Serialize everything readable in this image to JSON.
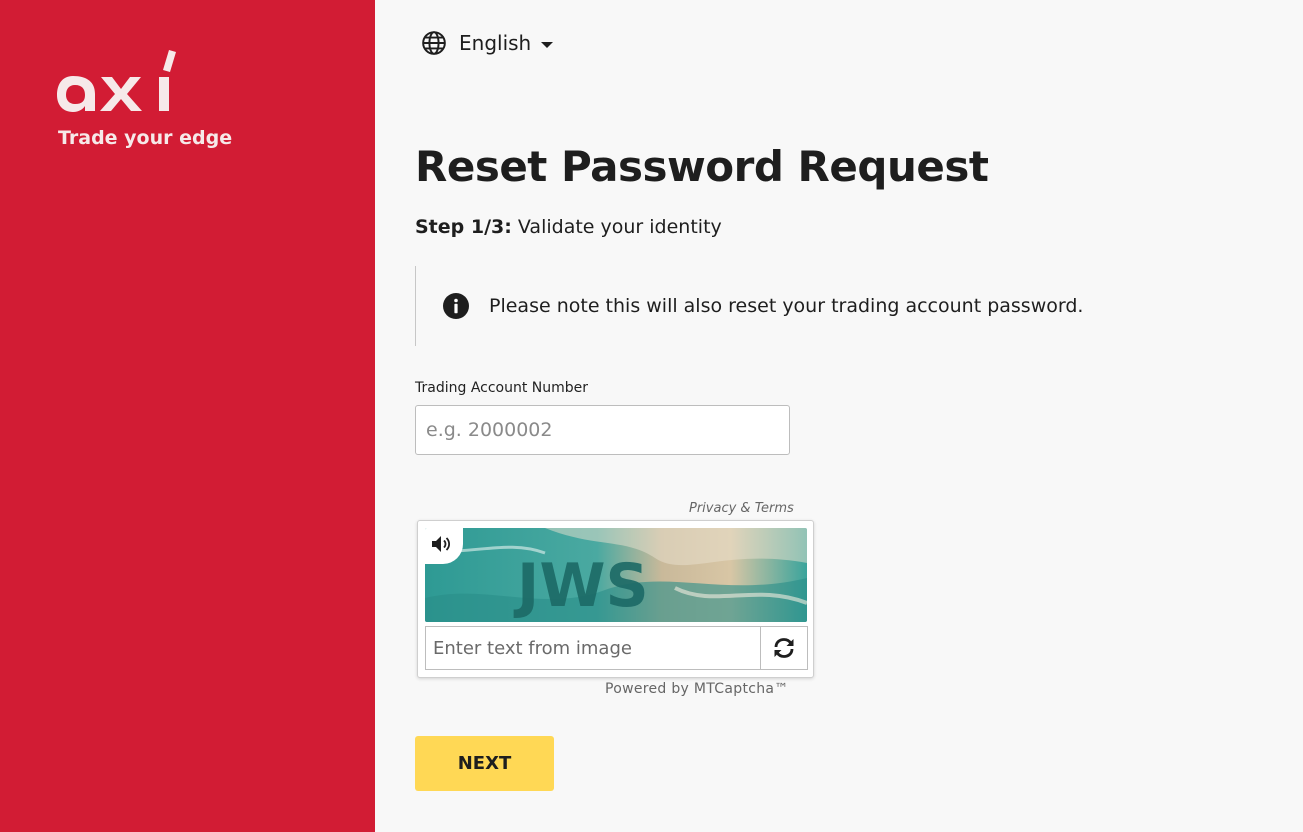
{
  "brand": {
    "logo_text": "axi",
    "tagline": "Trade your edge",
    "color": "#d21c34"
  },
  "language": {
    "selected": "English",
    "icon": "globe-icon"
  },
  "page": {
    "title": "Reset Password Request",
    "step_label": "Step 1/3:",
    "step_text": "Validate your identity"
  },
  "notice": {
    "icon": "info-icon",
    "text": "Please note this will also reset your trading account password."
  },
  "form": {
    "account_label": "Trading Account Number",
    "account_placeholder": "e.g. 2000002",
    "account_value": ""
  },
  "captcha": {
    "privacy_link": "Privacy & Terms",
    "input_placeholder": "Enter text from image",
    "image_text": "JWS",
    "powered_by": "Powered by MTCaptcha™"
  },
  "actions": {
    "next_label": "NEXT",
    "next_color": "#ffd855"
  }
}
